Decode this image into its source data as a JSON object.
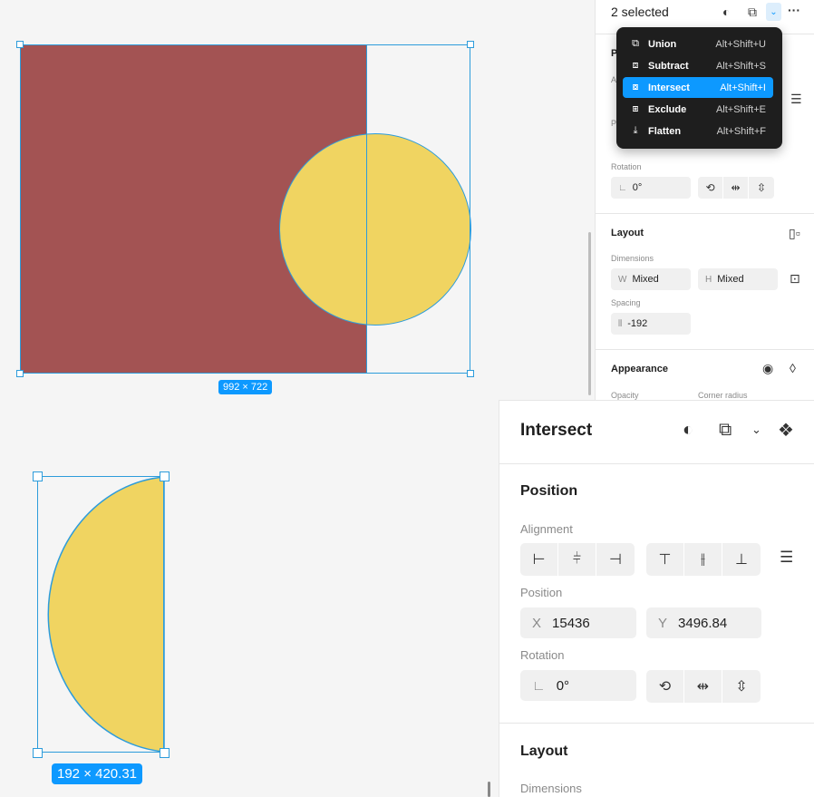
{
  "canvas": {
    "top_selection": {
      "dimensions_badge": "992 × 722",
      "fill_rect": "#a35353",
      "fill_circle": "#f0d461",
      "selection_color": "#2d9cdb"
    },
    "bottom_selection": {
      "dimensions_badge": "192 × 420.31"
    }
  },
  "top_panel": {
    "title": "2 selected",
    "icons": [
      "boolean-icon",
      "union-icon",
      "chevron-down-icon",
      "more-icon"
    ],
    "menu": {
      "items": [
        {
          "label": "Union",
          "shortcut": "Alt+Shift+U",
          "icon": "union-icon"
        },
        {
          "label": "Subtract",
          "shortcut": "Alt+Shift+S",
          "icon": "subtract-icon"
        },
        {
          "label": "Intersect",
          "shortcut": "Alt+Shift+I",
          "icon": "intersect-icon",
          "active": true
        },
        {
          "label": "Exclude",
          "shortcut": "Alt+Shift+E",
          "icon": "exclude-icon"
        },
        {
          "label": "Flatten",
          "shortcut": "Alt+Shift+F",
          "icon": "flatten-icon"
        }
      ]
    },
    "partial_labels": {
      "position_initial": "P",
      "alignment_initial": "A",
      "position2_initial": "P"
    },
    "rotation": {
      "label": "Rotation",
      "value": "0°"
    },
    "layout": {
      "header": "Layout",
      "dimensions_label": "Dimensions",
      "width_prefix": "W",
      "width_value": "Mixed",
      "height_prefix": "H",
      "height_value": "Mixed",
      "spacing_label": "Spacing",
      "spacing_value": "-192"
    },
    "appearance": {
      "header": "Appearance",
      "opacity_label": "Opacity",
      "corner_radius_label": "Corner radius"
    }
  },
  "big_panel": {
    "title": "Intersect",
    "position": {
      "header": "Position",
      "alignment_label": "Alignment",
      "position_label": "Position",
      "x_prefix": "X",
      "x_value": "15436",
      "y_prefix": "Y",
      "y_value": "3496.84",
      "rotation_label": "Rotation",
      "rotation_value": "0°"
    },
    "layout": {
      "header": "Layout",
      "dimensions_label": "Dimensions"
    }
  },
  "colors": {
    "accent": "#0d99ff",
    "menu_bg": "#1e1e1e"
  }
}
